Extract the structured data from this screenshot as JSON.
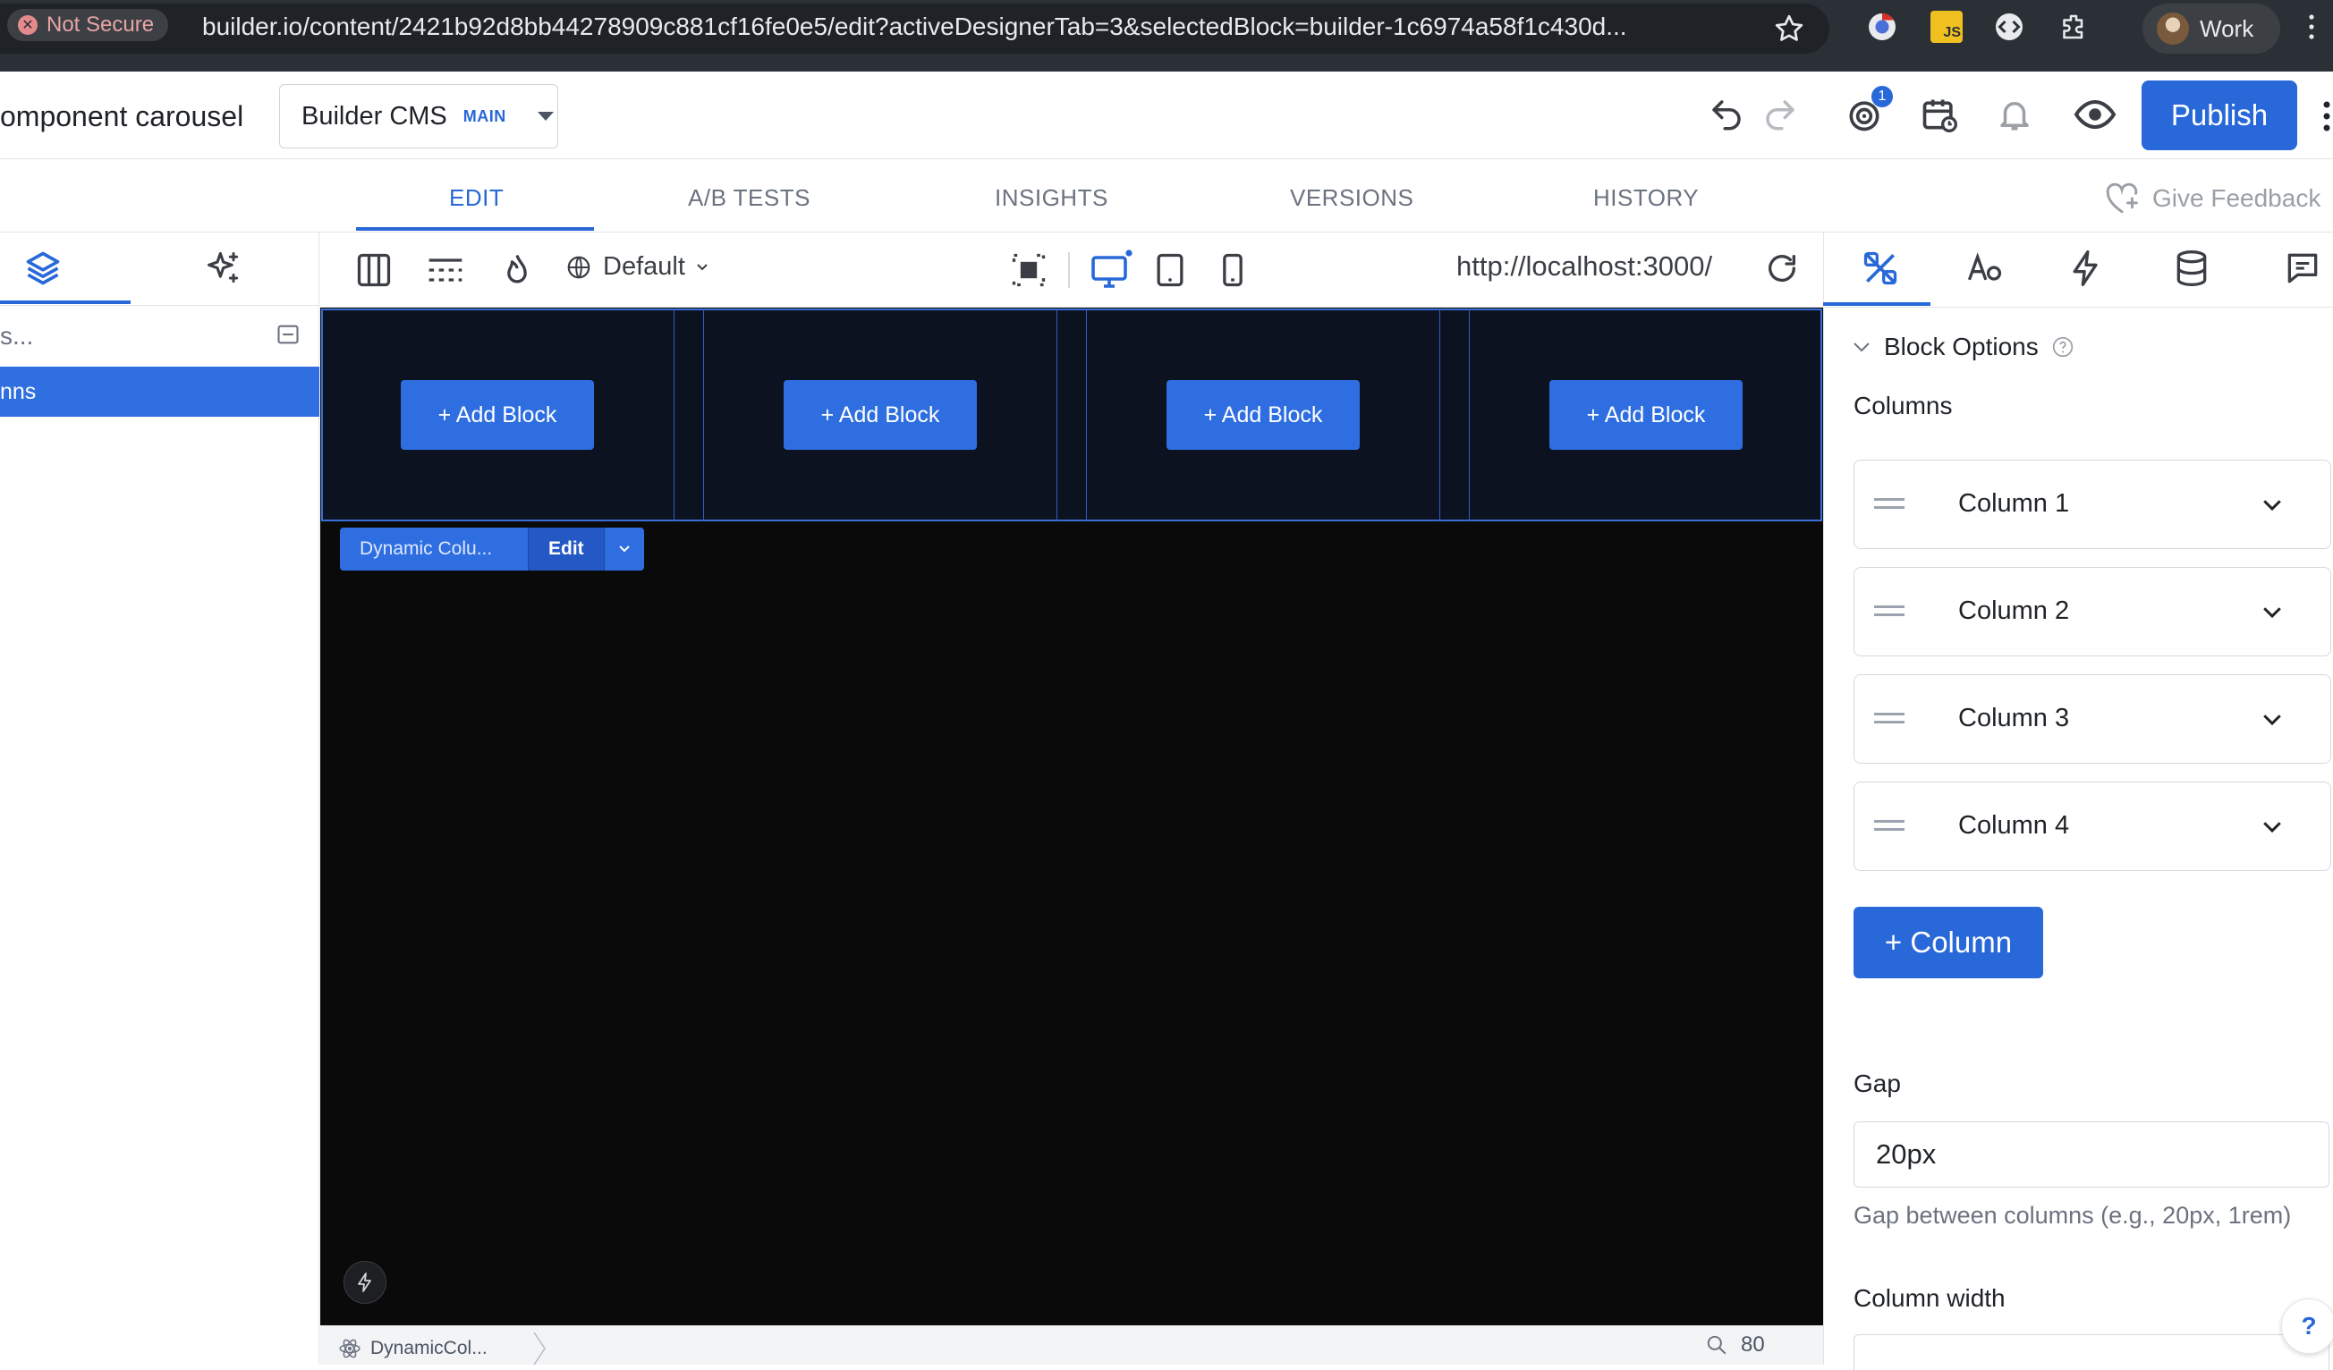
{
  "browser": {
    "security_label": "Not Secure",
    "url": "builder.io/content/2421b92d8bb44278909c881cf16fe0e5/edit?activeDesignerTab=3&selectedBlock=builder-1c6974a58f1c430d...",
    "profile_label": "Work",
    "extension_icons": [
      "bookmark-star-icon",
      "chrome-extension-icon",
      "js-extension-icon",
      "devtools-extension-icon",
      "puzzle-extensions-icon",
      "kebab-menu-icon"
    ]
  },
  "header": {
    "content_title": "omponent carousel",
    "space_name": "Builder CMS",
    "space_branch": "MAIN",
    "notification_count": "1",
    "publish_label": "Publish"
  },
  "tabs": [
    {
      "label": "EDIT",
      "active": true
    },
    {
      "label": "A/B TESTS",
      "active": false
    },
    {
      "label": "INSIGHTS",
      "active": false
    },
    {
      "label": "VERSIONS",
      "active": false
    },
    {
      "label": "HISTORY",
      "active": false
    }
  ],
  "feedback_label": "Give Feedback",
  "left_panel": {
    "search_placeholder": "s...",
    "selected_layer": "nns"
  },
  "canvas_toolbar": {
    "locale": "Default",
    "preview_url": "http://localhost:3000/"
  },
  "canvas": {
    "add_block_label": "+ Add Block",
    "column_count": 4,
    "selected_block_name": "Dynamic Colu...",
    "edit_label": "Edit"
  },
  "status_bar": {
    "breadcrumb": "DynamicCol...",
    "zoom": "80"
  },
  "right_panel": {
    "section_title": "Block Options",
    "columns_label": "Columns",
    "columns": [
      "Column 1",
      "Column 2",
      "Column 3",
      "Column 4"
    ],
    "add_column_label": "+ Column",
    "gap_label": "Gap",
    "gap_value": "20px",
    "gap_help": "Gap between columns (e.g., 20px, 1rem)",
    "column_width_label": "Column width"
  },
  "colors": {
    "accent": "#2868d8",
    "canvas_bg": "#0a0a0b",
    "chrome_bg": "#2b3036"
  }
}
